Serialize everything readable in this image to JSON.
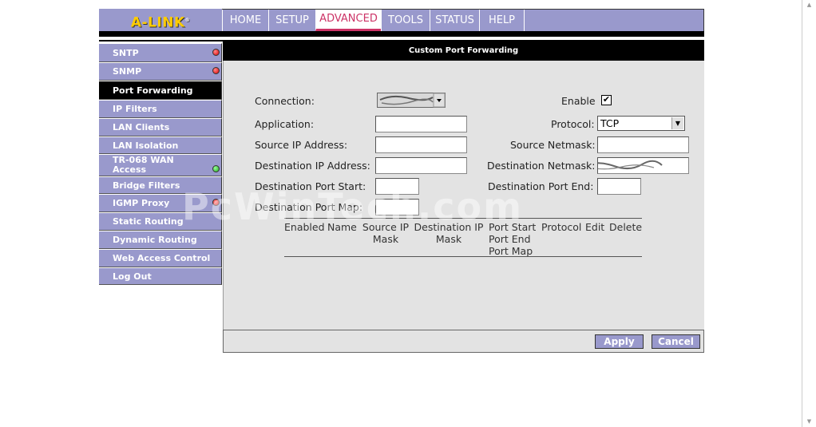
{
  "brand": {
    "logo": "A-LINK"
  },
  "nav": {
    "tabs": [
      {
        "label": "HOME"
      },
      {
        "label": "SETUP"
      },
      {
        "label": "ADVANCED"
      },
      {
        "label": "TOOLS"
      },
      {
        "label": "STATUS"
      },
      {
        "label": "HELP"
      }
    ],
    "active": "ADVANCED"
  },
  "sidebar": {
    "items": [
      {
        "label": "SNTP",
        "status": "red"
      },
      {
        "label": "SNMP",
        "status": "red"
      },
      {
        "label": "Port Forwarding",
        "status": "none",
        "active": true
      },
      {
        "label": "IP Filters",
        "status": "none"
      },
      {
        "label": "LAN Clients",
        "status": "none"
      },
      {
        "label": "LAN Isolation",
        "status": "none"
      },
      {
        "label": "TR-068 WAN Access",
        "status": "green"
      },
      {
        "label": "Bridge Filters",
        "status": "none"
      },
      {
        "label": "IGMP Proxy",
        "status": "red"
      },
      {
        "label": "Static Routing",
        "status": "none"
      },
      {
        "label": "Dynamic Routing",
        "status": "none"
      },
      {
        "label": "Web Access Control",
        "status": "none"
      },
      {
        "label": "Log Out",
        "status": "none"
      }
    ]
  },
  "page": {
    "title": "Custom Port Forwarding"
  },
  "form": {
    "connection_label": "Connection:",
    "enable_label": "Enable",
    "enable_checked": true,
    "application_label": "Application:",
    "application_value": "",
    "protocol_label": "Protocol:",
    "protocol_value": "TCP",
    "source_ip_label": "Source IP Address:",
    "source_ip_value": "",
    "source_netmask_label": "Source Netmask:",
    "source_netmask_value": "",
    "dest_ip_label": "Destination IP Address:",
    "dest_ip_value": "",
    "dest_netmask_label": "Destination Netmask:",
    "dest_port_start_label": "Destination Port Start:",
    "dest_port_start_value": "",
    "dest_port_end_label": "Destination Port End:",
    "dest_port_end_value": "",
    "dest_port_map_label": "Destination Port Map:",
    "dest_port_map_value": ""
  },
  "table": {
    "headers": [
      [
        "Enabled"
      ],
      [
        "Name"
      ],
      [
        "Source IP",
        "Mask"
      ],
      [
        "Destination IP",
        "Mask"
      ],
      [
        "Port Start",
        "Port End",
        "Port Map"
      ],
      [
        "Protocol"
      ],
      [
        "Edit"
      ],
      [
        "Delete"
      ]
    ],
    "rows": []
  },
  "buttons": {
    "apply": "Apply",
    "cancel": "Cancel"
  },
  "watermark": "PcWinTech.com",
  "colors": {
    "nav_bg": "#9999cc",
    "active_tab_text": "#cc3366",
    "logo": "#ffcc00",
    "panel_bg": "#e3e3e3"
  }
}
